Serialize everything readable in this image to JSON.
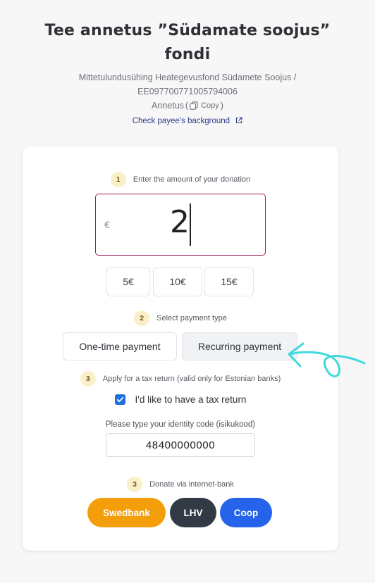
{
  "header": {
    "title_line1": "Tee annetus ”Südamate soojus”",
    "title_line2": "fondi",
    "payee_line1": "Mittetulundusühing Heategevusfond Südamete Soojus /",
    "payee_line2": "EE097700771005794006",
    "payee_line3": "Annetus",
    "copy_label": "Copy",
    "check_link": "Check payee's background"
  },
  "steps": {
    "amount": {
      "number": "1",
      "label": "Enter the amount of your donation"
    },
    "payment_type": {
      "number": "2",
      "label": "Select payment type"
    },
    "tax": {
      "number": "3",
      "label": "Apply for a tax return (valid only for Estonian banks)"
    },
    "bank": {
      "number": "3",
      "label": "Donate via internet-bank"
    }
  },
  "amount": {
    "currency": "€",
    "value": "2"
  },
  "presets": [
    "5€",
    "10€",
    "15€"
  ],
  "payment_types": {
    "one_time": "One-time payment",
    "recurring": "Recurring payment",
    "selected": "recurring"
  },
  "tax_return": {
    "checkbox_label": "I'd like to have a tax return",
    "checked": true,
    "id_label": "Please type your identity code (isikukood)",
    "id_value": "48400000000"
  },
  "banks": [
    {
      "label": "Swedbank",
      "color": "#f59e0b"
    },
    {
      "label": "LHV",
      "color": "#323a46"
    },
    {
      "label": "Coop",
      "color": "#2563eb"
    }
  ],
  "colors": {
    "accent_border": "#a0195d",
    "badge_bg": "#fbefc7",
    "checkbox": "#1f6fe0",
    "annotation_arrow": "#3fd9e0"
  }
}
